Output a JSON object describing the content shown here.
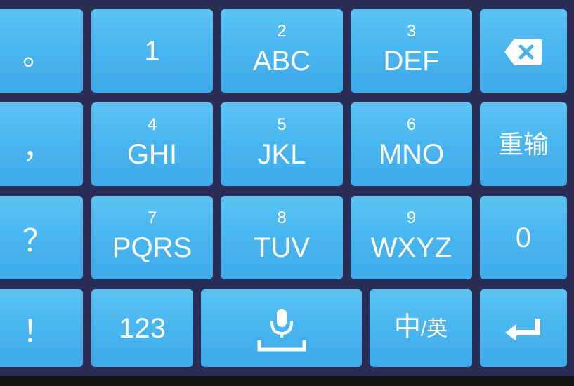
{
  "keyboard": {
    "side_keys": [
      {
        "label": "。"
      },
      {
        "label": "，"
      },
      {
        "label": "？"
      },
      {
        "label": "！"
      }
    ],
    "digit_keys": {
      "k1": {
        "main": "1"
      },
      "k2": {
        "digit": "2",
        "letters": "ABC"
      },
      "k3": {
        "digit": "3",
        "letters": "DEF"
      },
      "k4": {
        "digit": "4",
        "letters": "GHI"
      },
      "k5": {
        "digit": "5",
        "letters": "JKL"
      },
      "k6": {
        "digit": "6",
        "letters": "MNO"
      },
      "k7": {
        "digit": "7",
        "letters": "PQRS"
      },
      "k8": {
        "digit": "8",
        "letters": "TUV"
      },
      "k9": {
        "digit": "9",
        "letters": "WXYZ"
      },
      "k0": {
        "main": "0"
      }
    },
    "function_keys": {
      "backspace_icon": "backspace-icon",
      "reinput_label": "重输",
      "symbols_label": "123",
      "voice_icon": "microphone-icon",
      "lang_zh": "中",
      "lang_slash": "/",
      "lang_en": "英",
      "enter_icon": "enter-icon"
    },
    "colors": {
      "key_fill": "#49b6ef",
      "background": "#2b2d54",
      "text": "#ffffff"
    }
  }
}
